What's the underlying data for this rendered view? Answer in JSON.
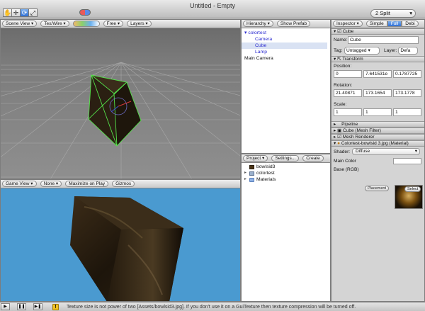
{
  "window": {
    "title": "Untitled - Empty"
  },
  "toolbar": {
    "tools": [
      {
        "name": "hand-tool",
        "glyph": "✋"
      },
      {
        "name": "move-tool",
        "glyph": "✛"
      },
      {
        "name": "rotate-tool",
        "glyph": "⟳"
      },
      {
        "name": "scale-tool",
        "glyph": "⤢"
      }
    ],
    "layout": "2 Split"
  },
  "scene_view": {
    "tab": "Scene View",
    "render_mode": "Tex/Wire",
    "camera_mode": "Free",
    "layers": "Layers"
  },
  "game_view": {
    "tab": "Game View",
    "aspect": "None",
    "maximize": "Maximize on Play",
    "gizmos": "Gizmos"
  },
  "hierarchy": {
    "tab": "Hierarchy",
    "show_prefab": "Show Prefab",
    "items": [
      {
        "label": "colortest",
        "level": 0,
        "expanded": true,
        "color": "#2b2bd0"
      },
      {
        "label": "Camera",
        "level": 1,
        "color": "#2b2bd0"
      },
      {
        "label": "Cube",
        "level": 1,
        "color": "#2b2bd0",
        "selected": true
      },
      {
        "label": "Lamp",
        "level": 1,
        "color": "#2b2bd0"
      },
      {
        "label": "Main Camera",
        "level": 0,
        "color": "#111111"
      }
    ]
  },
  "project": {
    "tab": "Project",
    "settings": "Settings...",
    "create": "Create",
    "items": [
      {
        "label": "bowlsid3",
        "icon": "texture-icon"
      },
      {
        "label": "colortest",
        "icon": "model-icon"
      },
      {
        "label": "Materials",
        "icon": "folder-icon"
      }
    ]
  },
  "inspector": {
    "tab": "Inspector",
    "modes": [
      "Simple",
      "Full",
      "Debug"
    ],
    "modes_display": [
      "Simple",
      "Full",
      "Debi"
    ],
    "object_header": "Cube",
    "name_label": "Name:",
    "name_value": "Cube",
    "tag_label": "Tag:",
    "tag_value": "Untagged",
    "layer_label": "Layer:",
    "layer_value": "Defa",
    "transform": {
      "title": "Transform",
      "position_label": "Position:",
      "position": [
        "0",
        "7.641531e",
        "0.1787725"
      ],
      "rotation_label": "Rotation:",
      "rotation": [
        "21.40871",
        "173.1654",
        "173.1778"
      ],
      "scale_label": "Scale:",
      "scale": [
        "1",
        "1",
        "1"
      ]
    },
    "pipeline": "Pipeline",
    "mesh_filter": "Cube (Mesh Filter)",
    "mesh_renderer": "Mesh Renderer",
    "material": "Colortest-bowlsid 3.jpg (Material)",
    "shader_label": "Shader:",
    "shader_value": "Diffuse",
    "main_color_label": "Main Color",
    "base_label": "Base (RGB)",
    "placement_btn": "Placement",
    "select_btn": "Select"
  },
  "status": {
    "message": "Texture size is not power of two [Assets/bowlsid3.jpg]. If you don't use it on a GuiTexture then texture compression will be turned off."
  },
  "colors": {
    "game_bg": "#4a9ad0",
    "selection": "#d9e2f3",
    "warning": "#f0c020"
  }
}
